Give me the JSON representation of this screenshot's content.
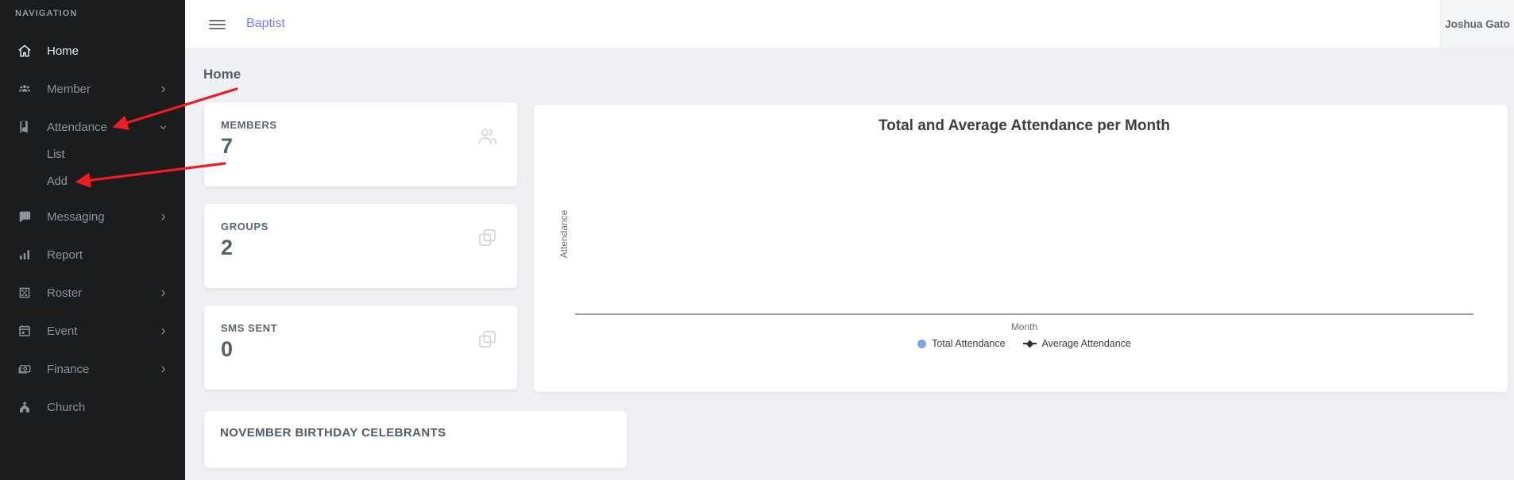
{
  "sidebar": {
    "section_label": "NAVIGATION",
    "items": [
      {
        "label": "Home",
        "icon": "home-icon",
        "chevron": "none",
        "active": true
      },
      {
        "label": "Member",
        "icon": "member-icon",
        "chevron": "right",
        "active": false
      },
      {
        "label": "Attendance",
        "icon": "attendance-icon",
        "chevron": "down",
        "active": false,
        "expanded": true
      },
      {
        "label": "Messaging",
        "icon": "messaging-icon",
        "chevron": "right",
        "active": false
      },
      {
        "label": "Report",
        "icon": "report-icon",
        "chevron": "none",
        "active": false
      },
      {
        "label": "Roster",
        "icon": "roster-icon",
        "chevron": "right",
        "active": false
      },
      {
        "label": "Event",
        "icon": "event-icon",
        "chevron": "right",
        "active": false
      },
      {
        "label": "Finance",
        "icon": "finance-icon",
        "chevron": "right",
        "active": false
      },
      {
        "label": "Church",
        "icon": "church-icon",
        "chevron": "none",
        "active": false
      }
    ],
    "attendance_children": [
      {
        "label": "List"
      },
      {
        "label": "Add"
      }
    ]
  },
  "topbar": {
    "brand": "Baptist",
    "user_name": "Joshua Gato"
  },
  "page": {
    "title": "Home"
  },
  "stats": [
    {
      "label": "MEMBERS",
      "value": "7",
      "icon": "people-outline-icon"
    },
    {
      "label": "GROUPS",
      "value": "2",
      "icon": "collections-icon"
    },
    {
      "label": "SMS SENT",
      "value": "0",
      "icon": "collections-icon"
    }
  ],
  "chart_data": {
    "type": "combo",
    "title": "Total and Average Attendance per Month",
    "xlabel": "Month",
    "ylabel": "Attendance",
    "categories": [],
    "series": [
      {
        "name": "Total Attendance",
        "type": "scatter",
        "color": "#78a7e2",
        "values": []
      },
      {
        "name": "Average Attendance",
        "type": "line",
        "color": "#2e3134",
        "values": []
      }
    ],
    "legend_position": "bottom",
    "grid": false
  },
  "birthday": {
    "title": "NOVEMBER BIRTHDAY CELEBRANTS"
  },
  "annotations": {
    "arrow_color": "#ee1c25",
    "arrows": [
      {
        "target": "Attendance"
      },
      {
        "target": "Add"
      }
    ]
  },
  "colors": {
    "sidebar_bg": "#1a1c1e",
    "brand_accent": "#767cf1",
    "content_bg": "#eef0f4",
    "legend_blue": "#78a7e2",
    "annotation_red": "#ee1c25"
  }
}
